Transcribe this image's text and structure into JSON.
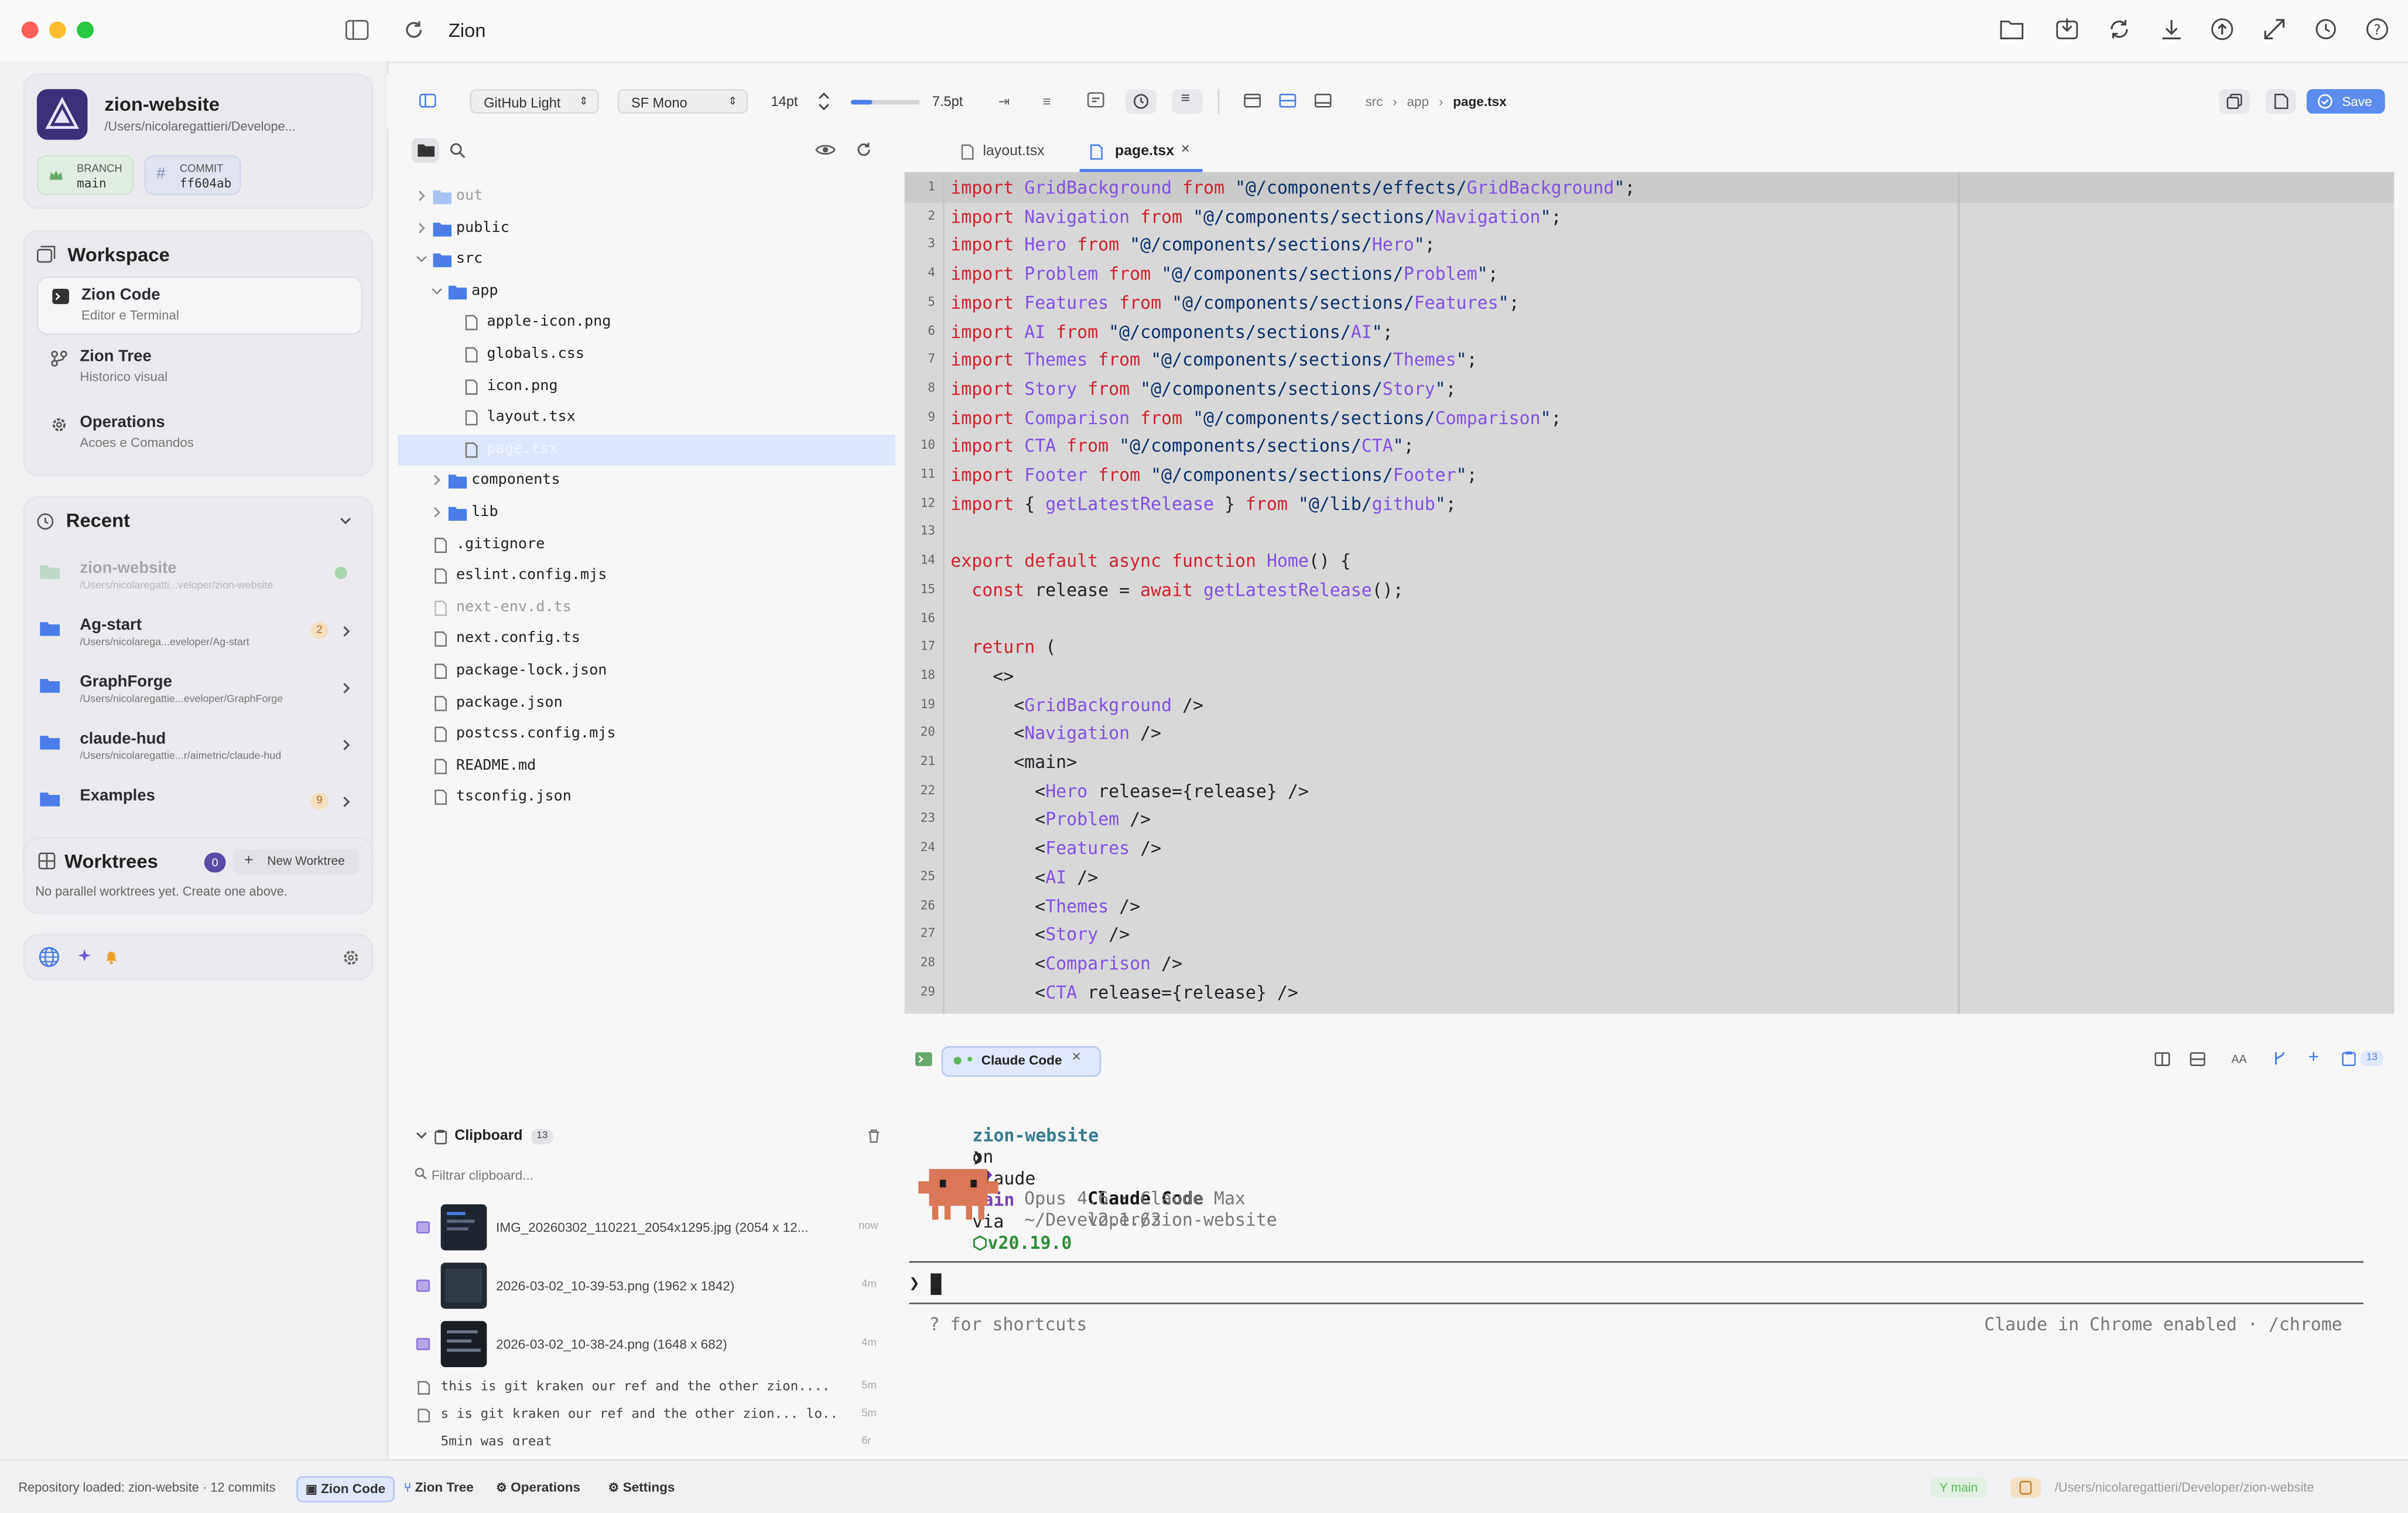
{
  "window": {
    "title": "Zion"
  },
  "project": {
    "name": "zion-website",
    "path": "/Users/nicolaregattieri/Develope...",
    "branch_label": "BRANCH",
    "branch": "main",
    "commit_label": "COMMIT",
    "commit": "ff604ab"
  },
  "workspace": {
    "title": "Workspace",
    "items": [
      {
        "title": "Zion Code",
        "subtitle": "Editor e Terminal"
      },
      {
        "title": "Zion Tree",
        "subtitle": "Historico visual"
      },
      {
        "title": "Operations",
        "subtitle": "Acoes e Comandos"
      }
    ]
  },
  "recent": {
    "title": "Recent",
    "items": [
      {
        "name": "zion-website",
        "path": "/Users/nicolaregatti...veloper/zion-website",
        "badge": ""
      },
      {
        "name": "Ag-start",
        "path": "/Users/nicolarega...eveloper/Ag-start",
        "badge": "2"
      },
      {
        "name": "GraphForge",
        "path": "/Users/nicolaregattie...eveloper/GraphForge",
        "badge": ""
      },
      {
        "name": "claude-hud",
        "path": "/Users/nicolaregattie...r/aimetric/claude-hud",
        "badge": ""
      },
      {
        "name": "Examples",
        "path": "",
        "badge": "9"
      }
    ]
  },
  "worktrees": {
    "title": "Worktrees",
    "count": "0",
    "new_button": "New Worktree",
    "empty": "No parallel worktrees yet. Create one above."
  },
  "toolbar": {
    "theme": "GitHub Light",
    "font": "SF Mono",
    "size": "14pt",
    "line_height": "7.5pt",
    "breadcrumb": [
      "src",
      "app",
      "page.tsx"
    ],
    "save": "Save"
  },
  "file_tree": [
    {
      "name": "out",
      "type": "folder",
      "depth": 0,
      "muted": true,
      "expanded": false
    },
    {
      "name": "public",
      "type": "folder",
      "depth": 0,
      "muted": false,
      "expanded": false
    },
    {
      "name": "src",
      "type": "folder",
      "depth": 0,
      "muted": false,
      "expanded": true
    },
    {
      "name": "app",
      "type": "folder",
      "depth": 1,
      "muted": false,
      "expanded": true
    },
    {
      "name": "apple-icon.png",
      "type": "file",
      "depth": 2,
      "muted": false
    },
    {
      "name": "globals.css",
      "type": "file",
      "depth": 2,
      "muted": false
    },
    {
      "name": "icon.png",
      "type": "file",
      "depth": 2,
      "muted": false
    },
    {
      "name": "layout.tsx",
      "type": "file",
      "depth": 2,
      "muted": false
    },
    {
      "name": "page.tsx",
      "type": "file",
      "depth": 2,
      "muted": false,
      "selected": true
    },
    {
      "name": "components",
      "type": "folder",
      "depth": 1,
      "muted": false,
      "expanded": false
    },
    {
      "name": "lib",
      "type": "folder",
      "depth": 1,
      "muted": false,
      "expanded": false
    },
    {
      "name": ".gitignore",
      "type": "file",
      "depth": 0,
      "muted": false
    },
    {
      "name": "eslint.config.mjs",
      "type": "file",
      "depth": 0,
      "muted": false
    },
    {
      "name": "next-env.d.ts",
      "type": "file",
      "depth": 0,
      "muted": true
    },
    {
      "name": "next.config.ts",
      "type": "file",
      "depth": 0,
      "muted": false
    },
    {
      "name": "package-lock.json",
      "type": "file",
      "depth": 0,
      "muted": false
    },
    {
      "name": "package.json",
      "type": "file",
      "depth": 0,
      "muted": false
    },
    {
      "name": "postcss.config.mjs",
      "type": "file",
      "depth": 0,
      "muted": false
    },
    {
      "name": "README.md",
      "type": "file",
      "depth": 0,
      "muted": false
    },
    {
      "name": "tsconfig.json",
      "type": "file",
      "depth": 0,
      "muted": false
    }
  ],
  "tabs": [
    {
      "label": "layout.tsx",
      "active": false
    },
    {
      "label": "page.tsx",
      "active": true
    }
  ],
  "code": [
    "import GridBackground from \"@/components/effects/GridBackground\";",
    "import Navigation from \"@/components/sections/Navigation\";",
    "import Hero from \"@/components/sections/Hero\";",
    "import Problem from \"@/components/sections/Problem\";",
    "import Features from \"@/components/sections/Features\";",
    "import AI from \"@/components/sections/AI\";",
    "import Themes from \"@/components/sections/Themes\";",
    "import Story from \"@/components/sections/Story\";",
    "import Comparison from \"@/components/sections/Comparison\";",
    "import CTA from \"@/components/sections/CTA\";",
    "import Footer from \"@/components/sections/Footer\";",
    "import { getLatestRelease } from \"@/lib/github\";",
    "",
    "export default async function Home() {",
    "  const release = await getLatestRelease();",
    "",
    "  return (",
    "    <>",
    "      <GridBackground />",
    "      <Navigation />",
    "      <main>",
    "        <Hero release={release} />",
    "        <Problem />",
    "        <Features />",
    "        <AI />",
    "        <Themes />",
    "        <Story />",
    "        <Comparison />",
    "        <CTA release={release} />"
  ],
  "terminal": {
    "tab": "Claude Code",
    "badge": "13",
    "prompt_dir": "zion-website",
    "prompt_on": "on",
    "prompt_branch": "main",
    "prompt_via": "via",
    "prompt_node": "v20.19.0",
    "command": "claude",
    "app_name": "Claude Code",
    "app_version": "v2.1.63",
    "model": "Opus 4.6 · Claude Max",
    "cwd": "~/Developer/zion-website",
    "shortcuts_hint": "? for shortcuts",
    "chrome_hint": "Claude in Chrome enabled · /chrome"
  },
  "clipboard": {
    "title": "Clipboard",
    "count": "13",
    "filter_placeholder": "Filtrar clipboard...",
    "images": [
      {
        "name": "IMG_20260302_110221_2054x1295.jpg (2054 x 12...",
        "time": "now"
      },
      {
        "name": "2026-03-02_10-39-53.png (1962 x 1842)",
        "time": "4m"
      },
      {
        "name": "2026-03-02_10-38-24.png (1648 x 682)",
        "time": "4m"
      }
    ],
    "texts": [
      {
        "text": "this is git kraken our ref and the other zion....",
        "time": "5m"
      },
      {
        "text": "s is git kraken our ref and the other zion... lo...",
        "time": "5m"
      },
      {
        "text": "5min was great",
        "time": "6m"
      }
    ]
  },
  "statusbar": {
    "message": "Repository loaded: zion-website · 12 commits",
    "tabs": [
      "Zion Code",
      "Zion Tree",
      "Operations",
      "Settings"
    ],
    "branch": "main",
    "path": "/Users/nicolaregattieri/Developer/zion-website"
  },
  "colors": {
    "accent": "#4a7de8",
    "save": "#5b8def",
    "purple": "#5a4ca8"
  }
}
